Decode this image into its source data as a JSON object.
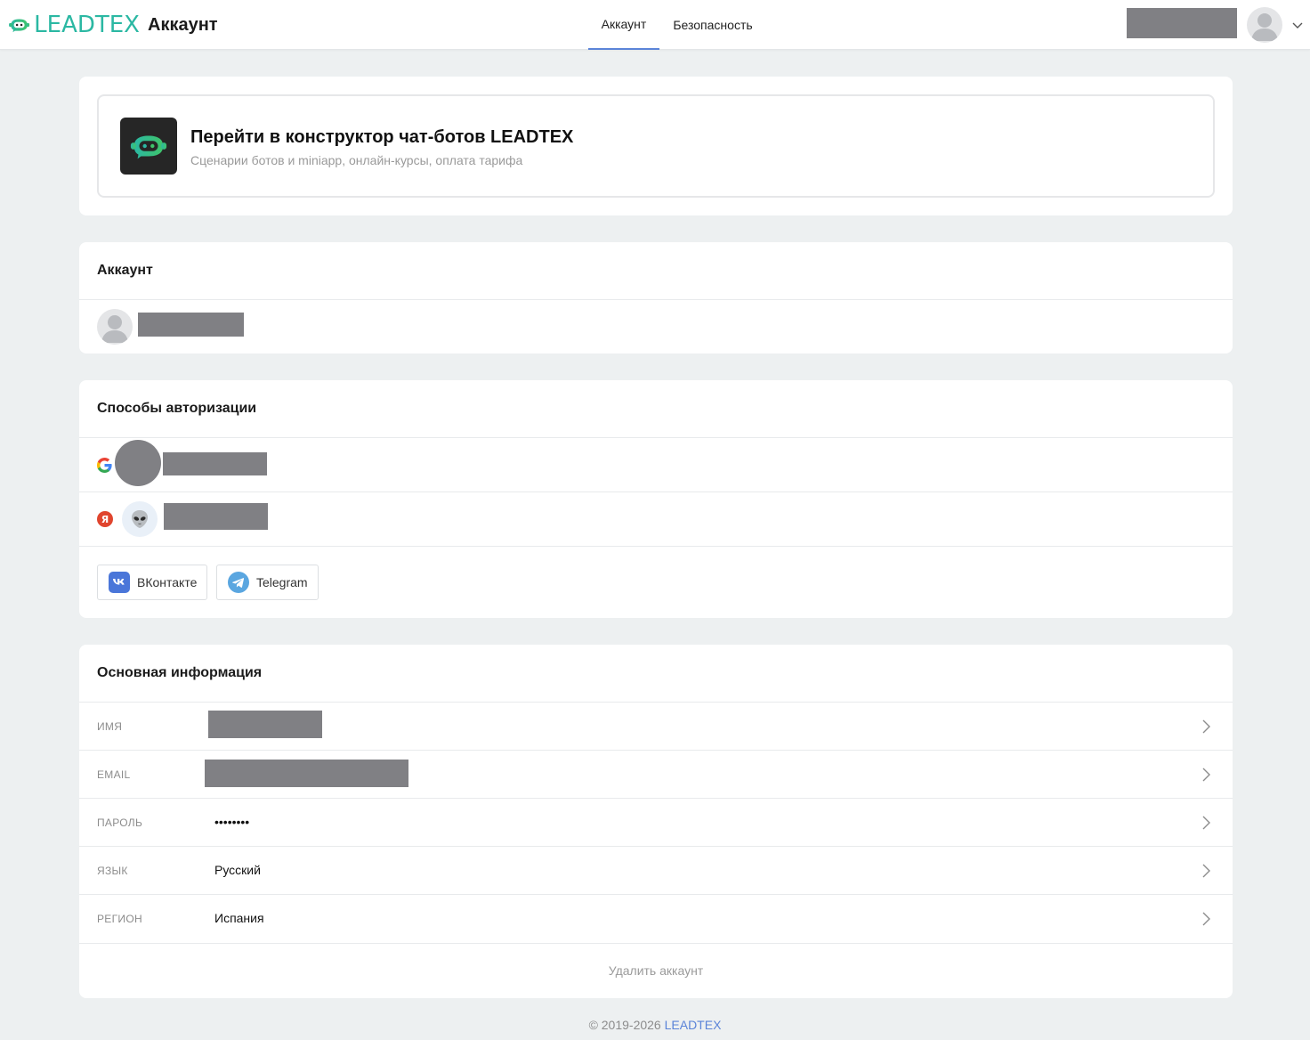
{
  "header": {
    "logo_text": "LEADTEX",
    "app_title": "Аккаунт",
    "tabs": [
      {
        "label": "Аккаунт",
        "active": true
      },
      {
        "label": "Безопасность",
        "active": false
      }
    ],
    "accent_color": "#5b84d8",
    "logo_color": "#2bb8a3"
  },
  "promo": {
    "title": "Перейти в конструктор чат-ботов LEADTEX",
    "subtitle": "Сценарии ботов и miniapp, онлайн-курсы, оплата тарифа"
  },
  "account": {
    "title": "Аккаунт"
  },
  "auth_methods": {
    "title": "Способы авторизации",
    "providers": [
      {
        "icon": "google-icon"
      },
      {
        "icon": "yandex-icon",
        "avatar": "alien-icon"
      }
    ],
    "buttons": [
      {
        "label": "ВКонтакте",
        "icon": "vk-icon",
        "color": "#4a76d9"
      },
      {
        "label": "Telegram",
        "icon": "telegram-icon",
        "color": "#5aa6e0"
      }
    ]
  },
  "basic_info": {
    "title": "Основная информация",
    "rows": [
      {
        "label": "ИМЯ",
        "value": ""
      },
      {
        "label": "EMAIL",
        "value": ""
      },
      {
        "label": "ПАРОЛЬ",
        "value": "••••••••"
      },
      {
        "label": "ЯЗЫК",
        "value": "Русский"
      },
      {
        "label": "РЕГИОН",
        "value": "Испания"
      }
    ],
    "delete_label": "Удалить аккаунт"
  },
  "footer": {
    "copyright": "© 2019-2026",
    "brand_link": "LEADTEX"
  }
}
